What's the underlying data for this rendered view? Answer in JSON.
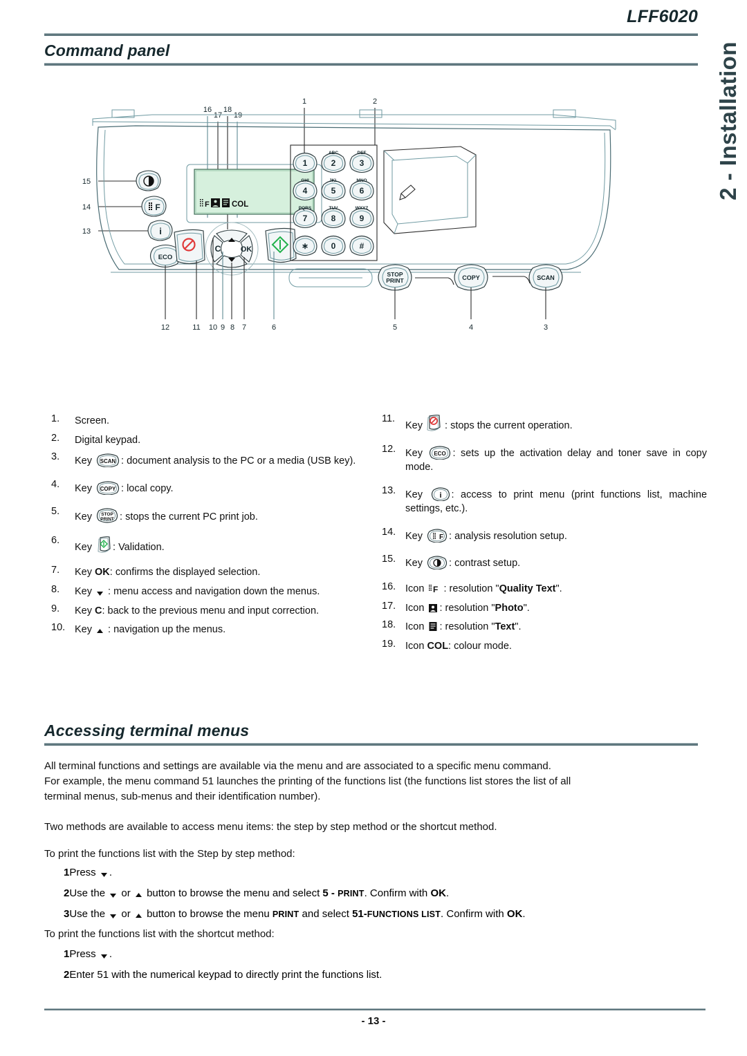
{
  "header": {
    "model": "LFF6020",
    "side_tab": "2 - Installation"
  },
  "sections": {
    "command_panel": "Command panel",
    "accessing_terminal_menus": "Accessing terminal menus"
  },
  "figure": {
    "alt": "LFF6020 command panel diagram",
    "callouts_top": [
      "16",
      "17",
      "18",
      "19",
      "1",
      "2"
    ],
    "callouts_left": [
      "15",
      "14",
      "13"
    ],
    "callouts_bottom": [
      "12",
      "11",
      "10",
      "9",
      "8",
      "7",
      "6",
      "5",
      "4",
      "3"
    ],
    "keypad": [
      {
        "digit": "1",
        "letters": ""
      },
      {
        "digit": "2",
        "letters": "ABC"
      },
      {
        "digit": "3",
        "letters": "DEF"
      },
      {
        "digit": "4",
        "letters": "GHI"
      },
      {
        "digit": "5",
        "letters": "JKL"
      },
      {
        "digit": "6",
        "letters": "MNO"
      },
      {
        "digit": "7",
        "letters": "PQRS"
      },
      {
        "digit": "8",
        "letters": "TUV"
      },
      {
        "digit": "9",
        "letters": "WXYZ"
      },
      {
        "digit": "∗",
        "letters": ""
      },
      {
        "digit": "0",
        "letters": ""
      },
      {
        "digit": "#",
        "letters": ""
      }
    ],
    "buttons": {
      "eco": "ECO",
      "ok": "OK",
      "c": "C",
      "stop_print_line1": "STOP",
      "stop_print_line2": "PRINT",
      "copy": "COPY",
      "scan": "SCAN"
    },
    "lcd": {
      "status_text": "COL",
      "screen_color": "#d6f0dd"
    }
  },
  "legend_left": [
    {
      "num": "1.",
      "text": "Screen."
    },
    {
      "num": "2.",
      "text": "Digital keypad."
    },
    {
      "num": "3.",
      "pre": "Key ",
      "icon": "scan-key-icon",
      "post": ": document analysis to the PC or a media (USB key)."
    },
    {
      "num": "4.",
      "pre": "Key ",
      "icon": "copy-key-icon",
      "post": ": local copy."
    },
    {
      "num": "5.",
      "pre": "Key ",
      "icon": "stop-print-key-icon",
      "post": ": stops the current PC print job."
    },
    {
      "num": "6.",
      "pre": "Key ",
      "icon": "validation-key-icon",
      "post": ": Validation."
    },
    {
      "num": "7.",
      "pre": "Key ",
      "bold": "OK",
      "post": ": confirms the displayed selection."
    },
    {
      "num": "8.",
      "pre": "Key ",
      "icon": "arrow-down-icon",
      "post": " : menu access and navigation down the menus."
    },
    {
      "num": "9.",
      "pre": "Key ",
      "bold": "C",
      "post": ": back to the previous menu and input correction."
    },
    {
      "num": "10.",
      "pre": "Key ",
      "icon": "arrow-up-icon",
      "post": " : navigation up the menus."
    }
  ],
  "legend_right": [
    {
      "num": "11.",
      "pre": "Key ",
      "icon": "stop-key-icon",
      "post": ": stops the current operation."
    },
    {
      "num": "12.",
      "pre": "Key ",
      "icon": "eco-key-icon",
      "post": ": sets up the activation delay and toner save in copy mode."
    },
    {
      "num": "13.",
      "pre": "Key ",
      "icon": "info-key-icon",
      "post": ": access to print menu (print functions list, machine settings, etc.)."
    },
    {
      "num": "14.",
      "pre": "Key ",
      "icon": "resolution-key-icon",
      "post": ": analysis resolution setup."
    },
    {
      "num": "15.",
      "pre": "Key ",
      "icon": "contrast-key-icon",
      "post": ": contrast setup."
    },
    {
      "num": "16.",
      "pre": "Icon ",
      "icon": "quality-text-icon",
      "mid": " : resolution \"",
      "bold": "Quality Text",
      "post": "\"."
    },
    {
      "num": "17.",
      "pre": "Icon ",
      "icon": "photo-icon",
      "mid": ": resolution \"",
      "bold": "Photo",
      "post": "\"."
    },
    {
      "num": "18.",
      "pre": "Icon ",
      "icon": "text-icon",
      "mid": ": resolution \"",
      "bold": "Text",
      "post": "\"."
    },
    {
      "num": "19.",
      "pre": "Icon ",
      "bold": "COL",
      "post": ": colour mode."
    }
  ],
  "body": {
    "para_1_line_1": "All terminal functions and settings are available via the menu and are associated to a specific menu command.",
    "para_1_line_2": "For example, the menu command 51 launches the printing of the functions list (the functions list stores the list of all",
    "para_1_line_3": "terminal menus, sub-menus and their identification number).",
    "para_2": "Two methods are available to access menu items: the step by step method or the shortcut method.",
    "para_3": "To print the functions list with the Step by step method:",
    "para_4": "To print the functions list with the shortcut method:"
  },
  "steps_step_by_step": [
    {
      "num": "1",
      "pre": "Press ",
      "icon": "arrow-down-icon",
      "post": "."
    },
    {
      "num": "2",
      "pre": "Use the ",
      "icon1": "arrow-down-icon",
      "mid1": " or ",
      "icon2": "arrow-up-icon",
      "mid2": " button to browse the menu and select ",
      "bold1": "5 - ",
      "sc1": "PRINT",
      "mid3": ". Confirm with ",
      "bold2": "OK",
      "post": "."
    },
    {
      "num": "3",
      "pre": "Use the ",
      "icon1": "arrow-down-icon",
      "mid1": " or ",
      "icon2": "arrow-up-icon",
      "mid2": " button to browse the menu ",
      "sc0": "PRINT",
      "mid2b": " and select ",
      "bold1": "51-",
      "sc1": "FUNCTIONS LIST",
      "mid3": ". Confirm with ",
      "bold2": "OK",
      "post": "."
    }
  ],
  "steps_shortcut": [
    {
      "num": "1",
      "pre": "Press ",
      "icon": "arrow-down-icon",
      "post": "."
    },
    {
      "num": "2",
      "pre": "Enter 51 with the numerical keypad to directly print the functions list.",
      "post": ""
    }
  ],
  "footer": {
    "page": "- 13 -"
  },
  "colors": {
    "rule": "#5f777e",
    "heading": "#16282d",
    "side_tab": "#2e4349",
    "lcd_green": "#d6f0dd",
    "panel_fill": "#eef3f4",
    "outline": "#4a6c74",
    "stop_red": "#e03a3a",
    "validate_green": "#22b14c"
  }
}
